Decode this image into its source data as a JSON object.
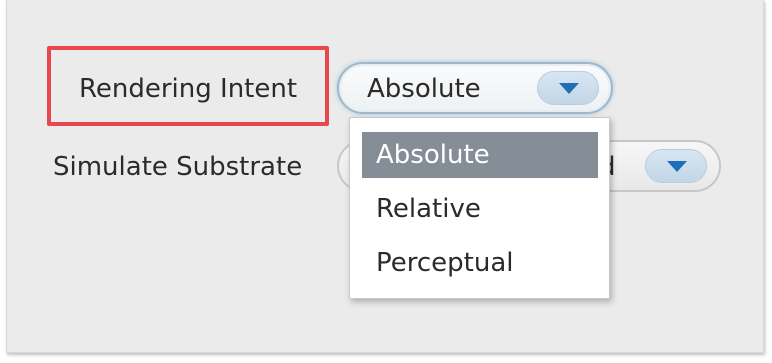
{
  "rendering_intent": {
    "label": "Rendering Intent",
    "selected_value": "Absolute",
    "options": [
      "Absolute",
      "Relative",
      "Perceptual"
    ],
    "selected_index": 0
  },
  "simulate_substrate": {
    "label": "Simulate Substrate",
    "visible_value_fragment": "d"
  },
  "colors": {
    "highlight": "#e8474d",
    "selected_option_bg": "#858e97",
    "arrow": "#1f6fb8"
  },
  "icons": {
    "combo_arrow": "chevron-down-icon"
  }
}
